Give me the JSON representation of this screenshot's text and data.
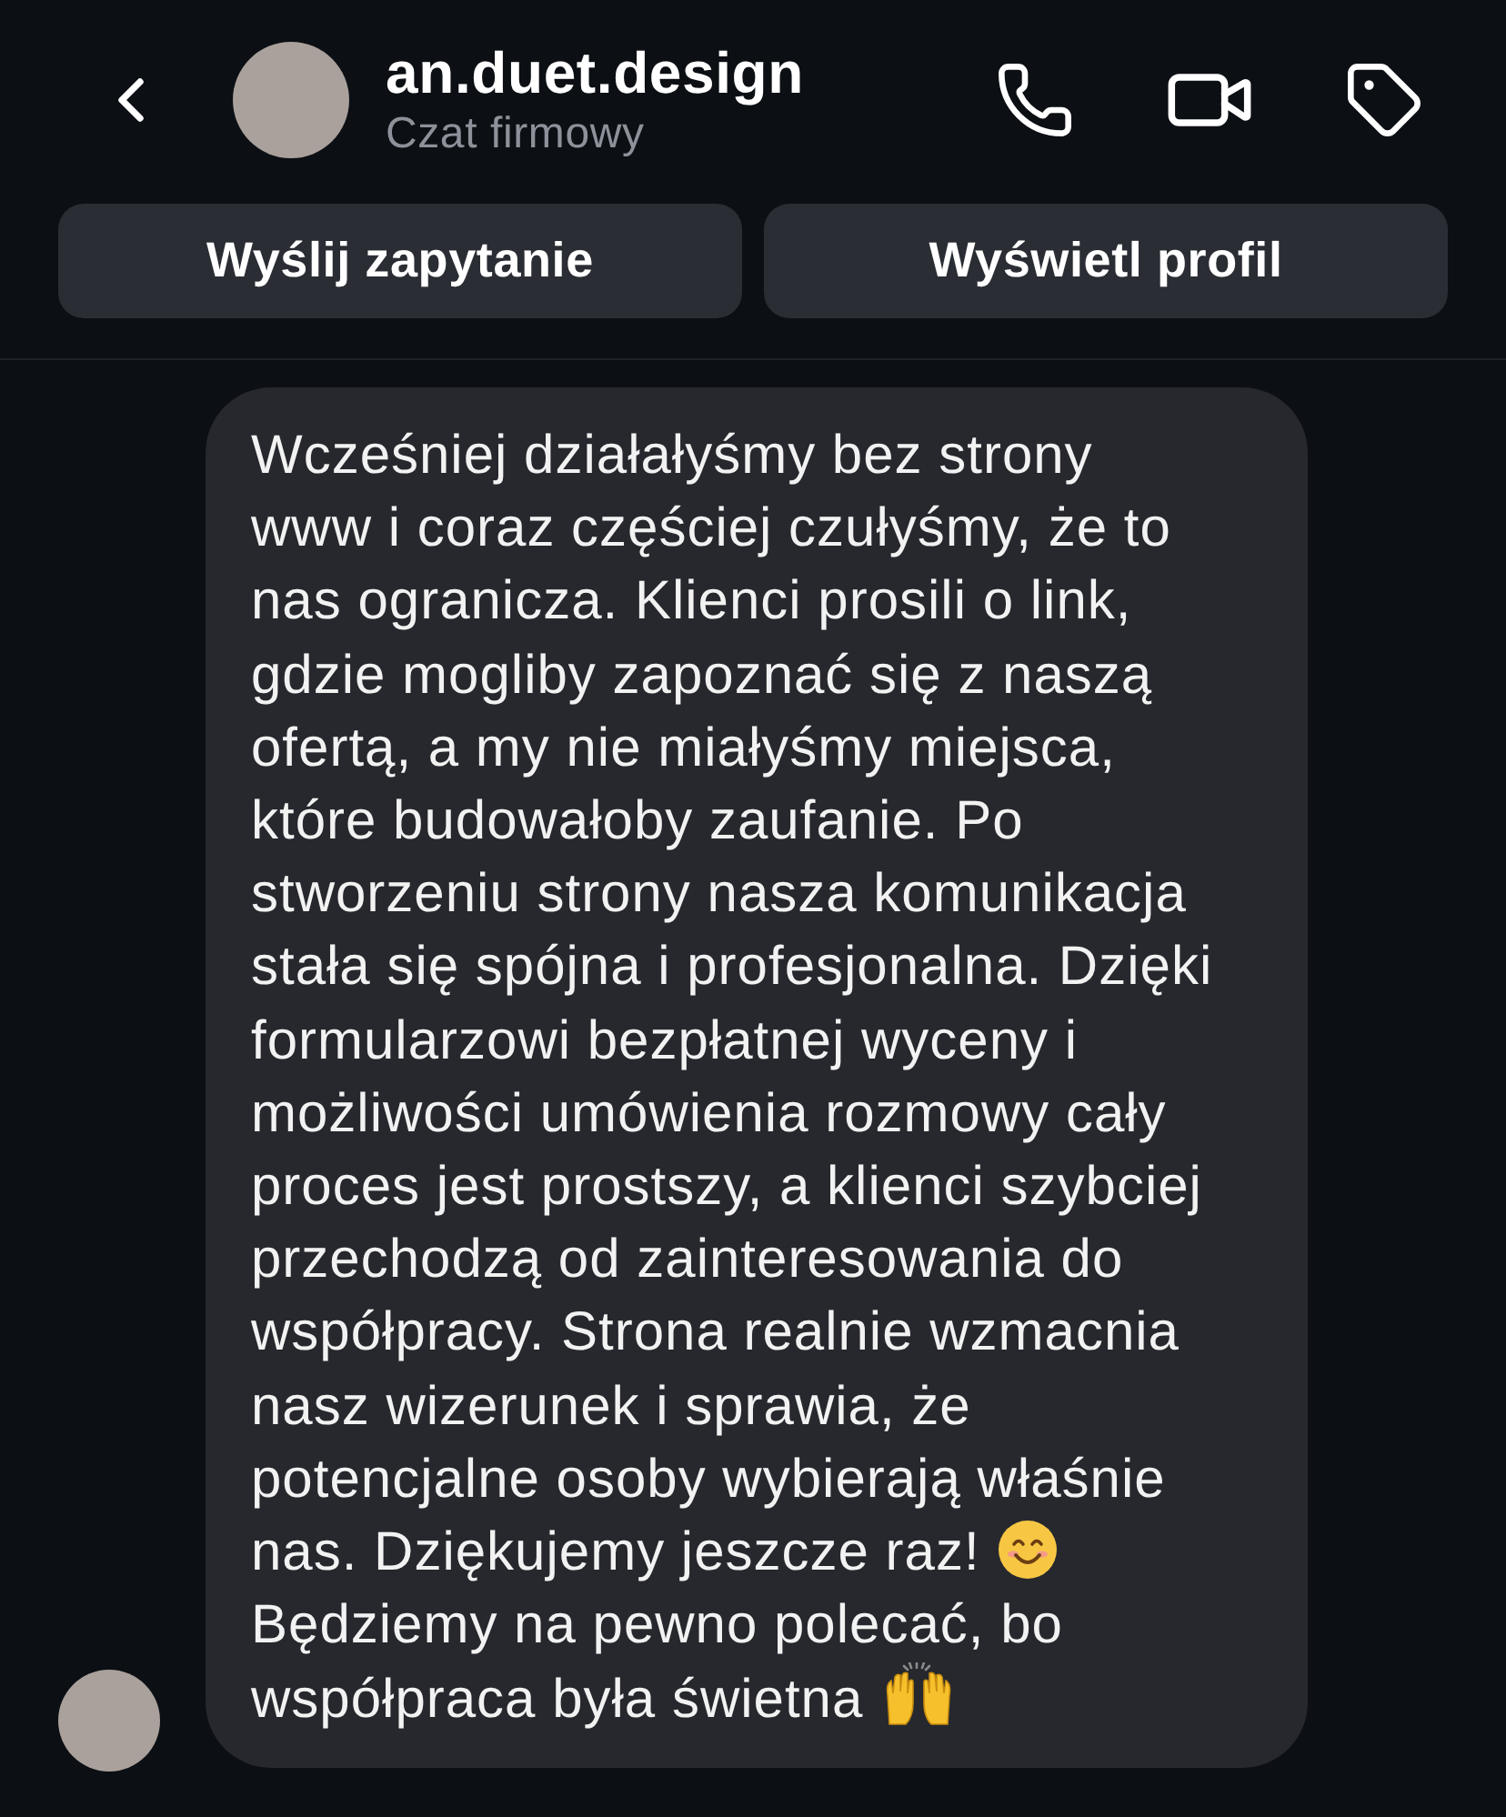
{
  "header": {
    "title": "an.duet.design",
    "subtitle": "Czat firmowy"
  },
  "actions": [
    {
      "label": "Wyślij zapytanie"
    },
    {
      "label": "Wyświetl profil"
    }
  ],
  "messages": [
    {
      "parts": [
        "Wcześniej działałyśmy bez strony www i coraz częściej czułyśmy, że to nas ogranicza. Klienci prosili o link, gdzie mogliby zapoznać się z naszą ofertą, a my nie miałyśmy miejsca, które budowałoby zaufanie. Po stworzeniu strony nasza komunikacja stała się spójna i profesjonalna. Dzięki formularzowi bezpłatnej wyceny i możliwości umówienia rozmowy cały proces jest prostszy, a klienci szybciej przechodzą od zainteresowania do współpracy. Strona realnie wzmacnia nasz wizerunek i sprawia, że potencjalne osoby wybierają właśnie nas. Dziękujemy jeszcze raz!",
        "Będziemy na pewno polecać, bo współpraca była świetna"
      ]
    }
  ]
}
